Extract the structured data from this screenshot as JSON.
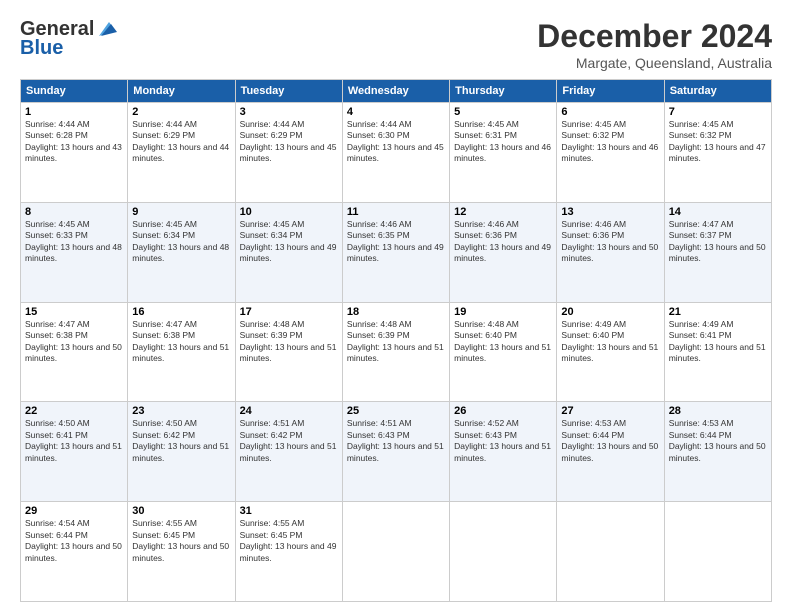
{
  "logo": {
    "line1": "General",
    "line2": "Blue"
  },
  "title": "December 2024",
  "subtitle": "Margate, Queensland, Australia",
  "days_of_week": [
    "Sunday",
    "Monday",
    "Tuesday",
    "Wednesday",
    "Thursday",
    "Friday",
    "Saturday"
  ],
  "weeks": [
    [
      {
        "day": "1",
        "sunrise": "4:44 AM",
        "sunset": "6:28 PM",
        "daylight": "13 hours and 43 minutes."
      },
      {
        "day": "2",
        "sunrise": "4:44 AM",
        "sunset": "6:29 PM",
        "daylight": "13 hours and 44 minutes."
      },
      {
        "day": "3",
        "sunrise": "4:44 AM",
        "sunset": "6:29 PM",
        "daylight": "13 hours and 45 minutes."
      },
      {
        "day": "4",
        "sunrise": "4:44 AM",
        "sunset": "6:30 PM",
        "daylight": "13 hours and 45 minutes."
      },
      {
        "day": "5",
        "sunrise": "4:45 AM",
        "sunset": "6:31 PM",
        "daylight": "13 hours and 46 minutes."
      },
      {
        "day": "6",
        "sunrise": "4:45 AM",
        "sunset": "6:32 PM",
        "daylight": "13 hours and 46 minutes."
      },
      {
        "day": "7",
        "sunrise": "4:45 AM",
        "sunset": "6:32 PM",
        "daylight": "13 hours and 47 minutes."
      }
    ],
    [
      {
        "day": "8",
        "sunrise": "4:45 AM",
        "sunset": "6:33 PM",
        "daylight": "13 hours and 48 minutes."
      },
      {
        "day": "9",
        "sunrise": "4:45 AM",
        "sunset": "6:34 PM",
        "daylight": "13 hours and 48 minutes."
      },
      {
        "day": "10",
        "sunrise": "4:45 AM",
        "sunset": "6:34 PM",
        "daylight": "13 hours and 49 minutes."
      },
      {
        "day": "11",
        "sunrise": "4:46 AM",
        "sunset": "6:35 PM",
        "daylight": "13 hours and 49 minutes."
      },
      {
        "day": "12",
        "sunrise": "4:46 AM",
        "sunset": "6:36 PM",
        "daylight": "13 hours and 49 minutes."
      },
      {
        "day": "13",
        "sunrise": "4:46 AM",
        "sunset": "6:36 PM",
        "daylight": "13 hours and 50 minutes."
      },
      {
        "day": "14",
        "sunrise": "4:47 AM",
        "sunset": "6:37 PM",
        "daylight": "13 hours and 50 minutes."
      }
    ],
    [
      {
        "day": "15",
        "sunrise": "4:47 AM",
        "sunset": "6:38 PM",
        "daylight": "13 hours and 50 minutes."
      },
      {
        "day": "16",
        "sunrise": "4:47 AM",
        "sunset": "6:38 PM",
        "daylight": "13 hours and 51 minutes."
      },
      {
        "day": "17",
        "sunrise": "4:48 AM",
        "sunset": "6:39 PM",
        "daylight": "13 hours and 51 minutes."
      },
      {
        "day": "18",
        "sunrise": "4:48 AM",
        "sunset": "6:39 PM",
        "daylight": "13 hours and 51 minutes."
      },
      {
        "day": "19",
        "sunrise": "4:48 AM",
        "sunset": "6:40 PM",
        "daylight": "13 hours and 51 minutes."
      },
      {
        "day": "20",
        "sunrise": "4:49 AM",
        "sunset": "6:40 PM",
        "daylight": "13 hours and 51 minutes."
      },
      {
        "day": "21",
        "sunrise": "4:49 AM",
        "sunset": "6:41 PM",
        "daylight": "13 hours and 51 minutes."
      }
    ],
    [
      {
        "day": "22",
        "sunrise": "4:50 AM",
        "sunset": "6:41 PM",
        "daylight": "13 hours and 51 minutes."
      },
      {
        "day": "23",
        "sunrise": "4:50 AM",
        "sunset": "6:42 PM",
        "daylight": "13 hours and 51 minutes."
      },
      {
        "day": "24",
        "sunrise": "4:51 AM",
        "sunset": "6:42 PM",
        "daylight": "13 hours and 51 minutes."
      },
      {
        "day": "25",
        "sunrise": "4:51 AM",
        "sunset": "6:43 PM",
        "daylight": "13 hours and 51 minutes."
      },
      {
        "day": "26",
        "sunrise": "4:52 AM",
        "sunset": "6:43 PM",
        "daylight": "13 hours and 51 minutes."
      },
      {
        "day": "27",
        "sunrise": "4:53 AM",
        "sunset": "6:44 PM",
        "daylight": "13 hours and 50 minutes."
      },
      {
        "day": "28",
        "sunrise": "4:53 AM",
        "sunset": "6:44 PM",
        "daylight": "13 hours and 50 minutes."
      }
    ],
    [
      {
        "day": "29",
        "sunrise": "4:54 AM",
        "sunset": "6:44 PM",
        "daylight": "13 hours and 50 minutes."
      },
      {
        "day": "30",
        "sunrise": "4:55 AM",
        "sunset": "6:45 PM",
        "daylight": "13 hours and 50 minutes."
      },
      {
        "day": "31",
        "sunrise": "4:55 AM",
        "sunset": "6:45 PM",
        "daylight": "13 hours and 49 minutes."
      },
      null,
      null,
      null,
      null
    ]
  ]
}
